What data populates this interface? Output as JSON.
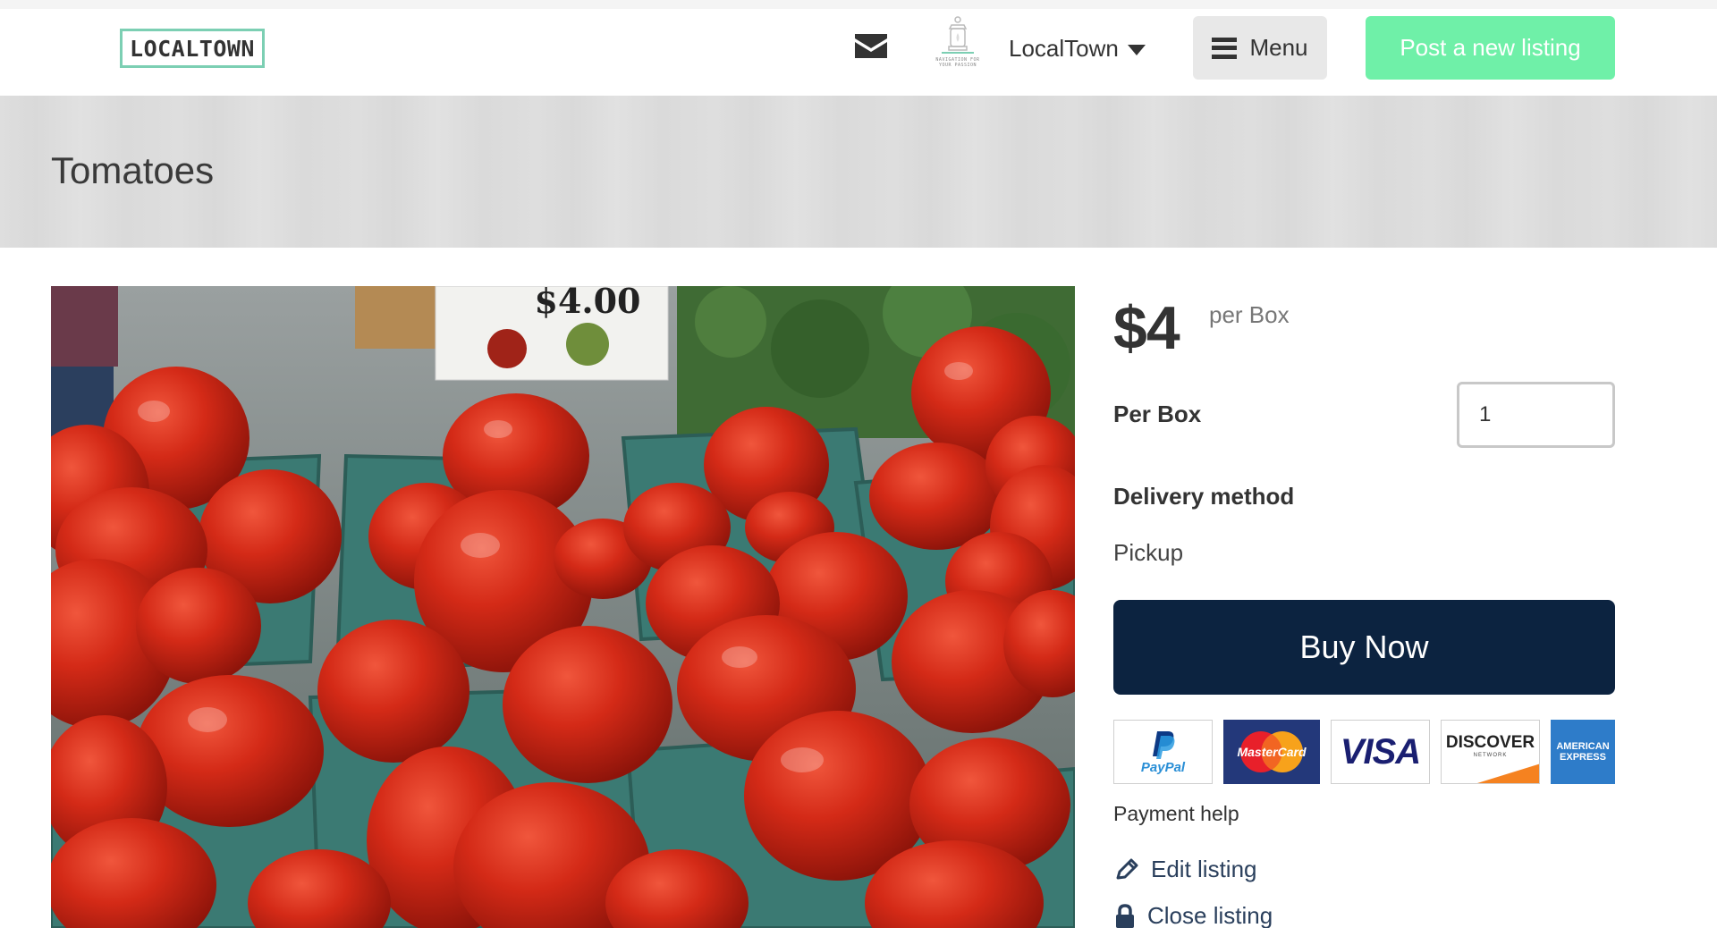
{
  "header": {
    "logo_text": "LOCALTOWN",
    "org_tagline_line1": "NAVIGATION FOR",
    "org_tagline_line2": "YOUR PASSION",
    "org_name": "LocalTown",
    "menu_label": "Menu",
    "post_listing_label": "Post a new listing",
    "icons": [
      "envelope-icon",
      "lantern-icon",
      "caret-down-icon",
      "hamburger-icon"
    ]
  },
  "listing": {
    "title": "Tomatoes",
    "image_sign_price": "$4.00",
    "price": "$4",
    "price_unit": "per Box",
    "quantity_label": "Per Box",
    "quantity_value": "1",
    "delivery_label": "Delivery method",
    "delivery_value": "Pickup",
    "buy_label": "Buy Now"
  },
  "payments": {
    "methods": [
      "PayPal",
      "MasterCard",
      "VISA",
      "DISCOVER",
      "AMERICAN EXPRESS"
    ],
    "discover_sub": "NETWORK",
    "help_label": "Payment help"
  },
  "actions": {
    "edit_label": "Edit listing",
    "close_label": "Close listing"
  },
  "colors": {
    "accent_green": "#6ff0a8",
    "logo_border": "#7ccfb3",
    "buy_button": "#0c2340",
    "action_text": "#2a3f5c"
  }
}
